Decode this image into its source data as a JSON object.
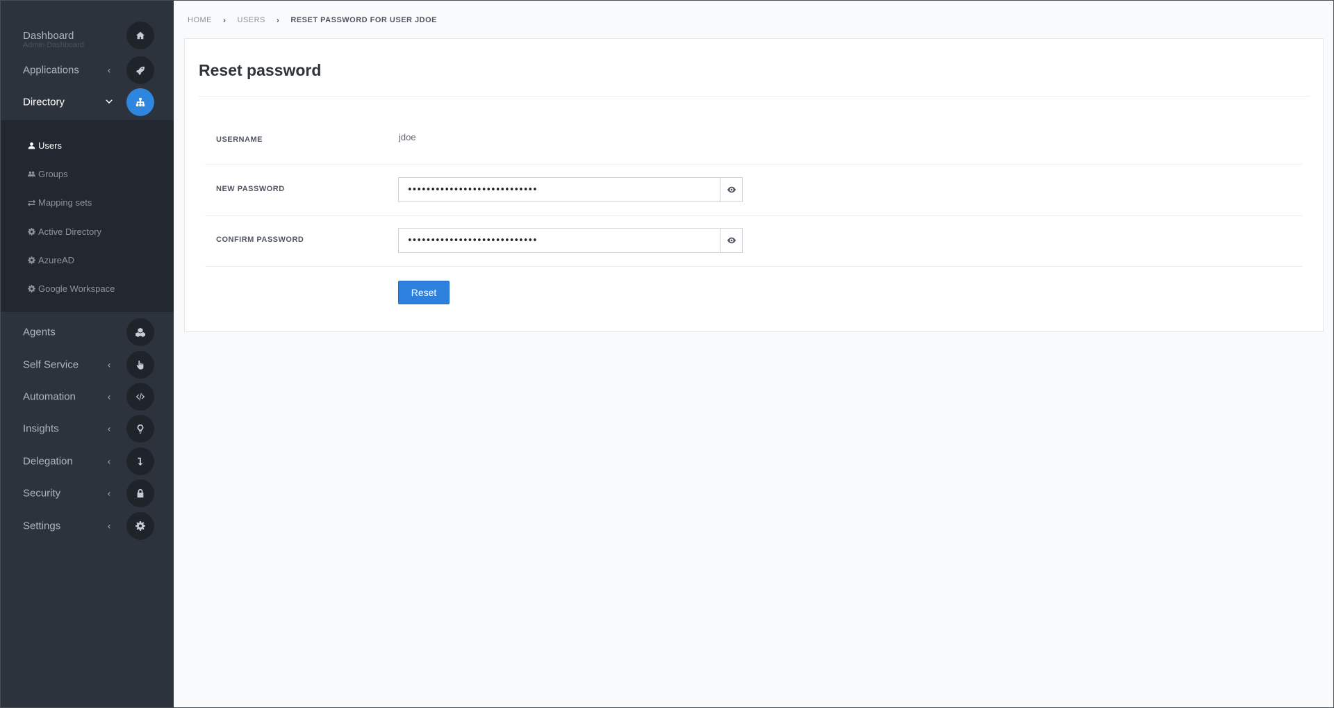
{
  "sidebar": {
    "dashboard": {
      "label": "Dashboard",
      "sub": "Admin Dashboard",
      "icon": "home-icon"
    },
    "items": [
      {
        "label": "Applications",
        "chevron": "‹",
        "icon": "rocket-icon"
      },
      {
        "label": "Directory",
        "chevron": "⌄",
        "icon": "sitemap-icon",
        "active": true
      },
      {
        "label": "Agents",
        "icon": "cubes-icon"
      },
      {
        "label": "Self Service",
        "chevron": "‹",
        "icon": "hand-pointer-icon"
      },
      {
        "label": "Automation",
        "chevron": "‹",
        "icon": "code-icon"
      },
      {
        "label": "Insights",
        "chevron": "‹",
        "icon": "lightbulb-icon"
      },
      {
        "label": "Delegation",
        "chevron": "‹",
        "icon": "level-down-icon"
      },
      {
        "label": "Security",
        "chevron": "‹",
        "icon": "lock-icon"
      },
      {
        "label": "Settings",
        "chevron": "‹",
        "icon": "gear-icon"
      }
    ],
    "directory_sub": [
      {
        "label": "Users",
        "icon": "user-icon",
        "active": true
      },
      {
        "label": "Groups",
        "icon": "users-icon"
      },
      {
        "label": "Mapping sets",
        "icon": "exchange-icon"
      },
      {
        "label": "Active Directory",
        "icon": "cog-icon"
      },
      {
        "label": "AzureAD",
        "icon": "cog-icon"
      },
      {
        "label": "Google Workspace",
        "icon": "cog-icon"
      }
    ]
  },
  "breadcrumb": {
    "home": "HOME",
    "users": "USERS",
    "current": "RESET PASSWORD FOR USER JDOE"
  },
  "form": {
    "title": "Reset password",
    "username_label": "USERNAME",
    "username_value": "jdoe",
    "new_password_label": "NEW PASSWORD",
    "new_password_value": "••••••••••••••••••••••••••••",
    "confirm_password_label": "CONFIRM PASSWORD",
    "confirm_password_value": "••••••••••••••••••••••••••••",
    "reset_button": "Reset"
  },
  "colors": {
    "sidebar_bg": "#2d333d",
    "subnav_bg": "#23272f",
    "accent": "#2e80df",
    "page_bg": "#f9fafb"
  }
}
